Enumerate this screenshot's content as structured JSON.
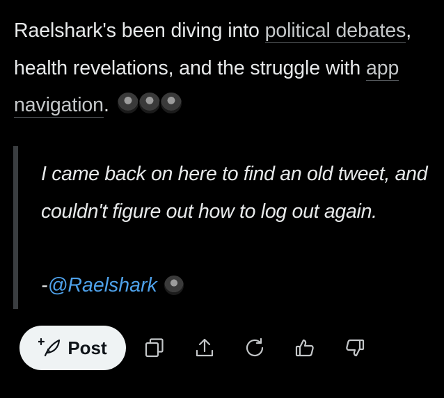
{
  "summary": {
    "text_before": "Raelshark's been diving into ",
    "topic_1": "political debates",
    "text_middle": ", health revelations, and the struggle with ",
    "topic_2": "app navigation",
    "text_after": "."
  },
  "quote": {
    "text": "I came back on here to find an old tweet, and couldn't figure out how to log out again.",
    "attribution_prefix": "-",
    "handle": "@Raelshark"
  },
  "actions": {
    "post_label": "Post"
  },
  "icons": {
    "post": "feather-plus-icon",
    "copy": "copy-icon",
    "share": "share-icon",
    "regenerate": "refresh-icon",
    "like": "thumbs-up-icon",
    "dislike": "thumbs-down-icon"
  },
  "colors": {
    "background": "#000000",
    "text": "#e7e9ea",
    "link": "#4ea1ea",
    "button_bg": "#eff3f4"
  }
}
